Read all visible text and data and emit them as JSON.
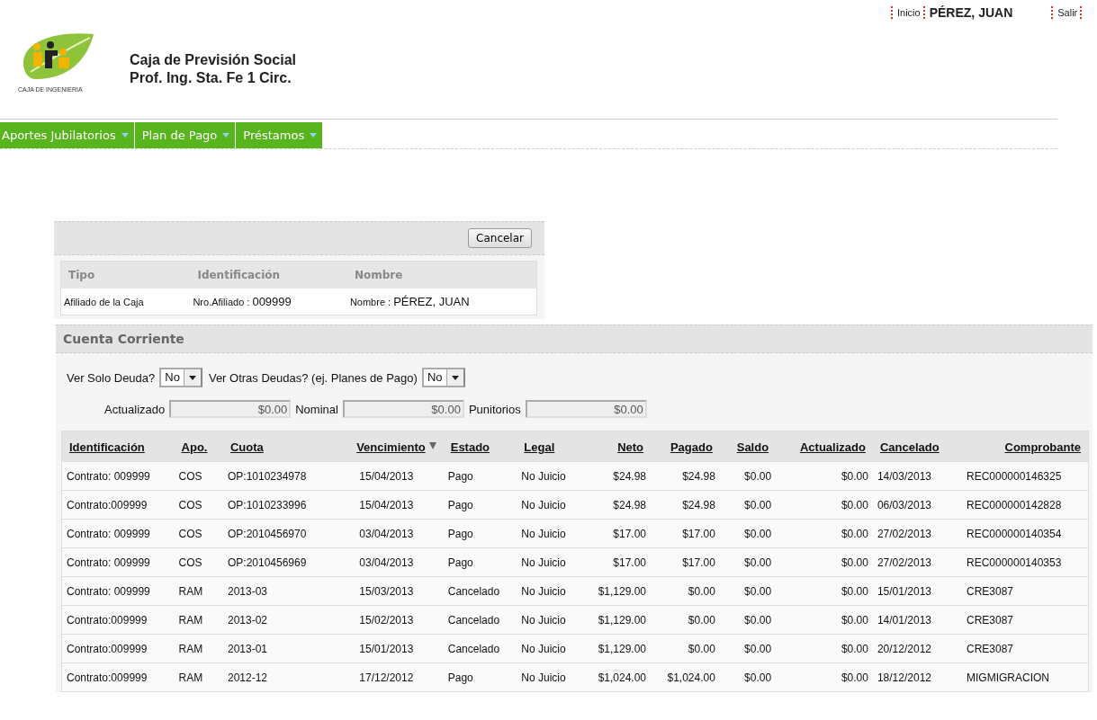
{
  "header": {
    "logo_caption": "CAJA DE INGENIERIA",
    "org_name": [
      "Caja de Previsión Social",
      "Prof. Ing. Sta. Fe 1 Circ."
    ],
    "links": [
      {
        "kind": "link",
        "label": "Inicio"
      },
      {
        "kind": "user",
        "label": "PÉREZ, JUAN"
      },
      {
        "kind": "link",
        "label": "Salir"
      }
    ]
  },
  "menu": [
    {
      "label": "Aportes Jubilatorios"
    },
    {
      "label": "Plan de Pago"
    },
    {
      "label": "Préstamos"
    }
  ],
  "affiliate_panel": {
    "button": "Cancelar",
    "columns": [
      "Tipo",
      "Identificación",
      "Nombre"
    ],
    "row": {
      "tipo": "Afiliado de la Caja",
      "id_label": "Nro.Afiliado :",
      "id_value": "009999",
      "name_label": "Nombre :",
      "name_value": "PÉREZ, JUAN"
    }
  },
  "account": {
    "title": "Cuenta Corriente",
    "filters": [
      {
        "label": "Ver Solo Deuda?",
        "value": "No"
      },
      {
        "label": "Ver Otras Deudas? (ej. Planes de Pago)",
        "value": "No"
      }
    ],
    "totals": [
      {
        "label": "Actualizado",
        "value": "$0.00"
      },
      {
        "label": "Nominal",
        "value": "$0.00"
      },
      {
        "label": "Punitorios",
        "value": "$0.00"
      }
    ],
    "table": {
      "columns": [
        {
          "label": "Identificación",
          "sorted": false
        },
        {
          "label": "Apo.",
          "sorted": false
        },
        {
          "label": "Cuota",
          "sorted": false
        },
        {
          "label": "Vencimiento",
          "sorted": true
        },
        {
          "label": "Estado",
          "sorted": false
        },
        {
          "label": "Legal",
          "sorted": false
        },
        {
          "label": "Neto",
          "sorted": false
        },
        {
          "label": "Pagado",
          "sorted": false
        },
        {
          "label": "Saldo",
          "sorted": false
        },
        {
          "label": "Actualizado",
          "sorted": false
        },
        {
          "label": "Cancelado",
          "sorted": false
        },
        {
          "label": "Comprobante",
          "sorted": false
        }
      ],
      "rows": [
        [
          "Contrato: 009999",
          "COS",
          "OP:1010234978",
          "15/04/2013",
          "Pago",
          "No Juicio",
          "$24.98",
          "$24.98",
          "$0.00",
          "$0.00",
          "14/03/2013",
          "REC000000146325"
        ],
        [
          "Contrato:009999",
          "COS",
          "OP:1010233996",
          "15/04/2013",
          "Pago",
          "No Juicio",
          "$24.98",
          "$24.98",
          "$0.00",
          "$0.00",
          "06/03/2013",
          "REC000000142828"
        ],
        [
          "Contrato: 009999",
          "COS",
          "OP:2010456970",
          "03/04/2013",
          "Pago",
          "No Juicio",
          "$17.00",
          "$17.00",
          "$0.00",
          "$0.00",
          "27/02/2013",
          "REC000000140354"
        ],
        [
          "Contrato: 009999",
          "COS",
          "OP:2010456969",
          "03/04/2013",
          "Pago",
          "No Juicio",
          "$17.00",
          "$17.00",
          "$0.00",
          "$0.00",
          "27/02/2013",
          "REC000000140353"
        ],
        [
          "Contrato: 009999",
          "RAM",
          "2013-03",
          "15/03/2013",
          "Cancelado",
          "No Juicio",
          "$1,129.00",
          "$0.00",
          "$0.00",
          "$0.00",
          "15/01/2013",
          "CRE3087"
        ],
        [
          "Contrato:009999",
          "RAM",
          "2013-02",
          "15/02/2013",
          "Cancelado",
          "No Juicio",
          "$1,129.00",
          "$0.00",
          "$0.00",
          "$0.00",
          "14/01/2013",
          "CRE3087"
        ],
        [
          "Contrato:009999",
          "RAM",
          "2013-01",
          "15/01/2013",
          "Cancelado",
          "No Juicio",
          "$1,129.00",
          "$0.00",
          "$0.00",
          "$0.00",
          "20/12/2012",
          "CRE3087"
        ],
        [
          "Contrato:009999",
          "RAM",
          "2012-12",
          "17/12/2012",
          "Pago",
          "No Juicio",
          "$1,024.00",
          "$1,024.00",
          "$0.00",
          "$0.00",
          "18/12/2012",
          "MIGMIGRACION"
        ]
      ]
    }
  }
}
